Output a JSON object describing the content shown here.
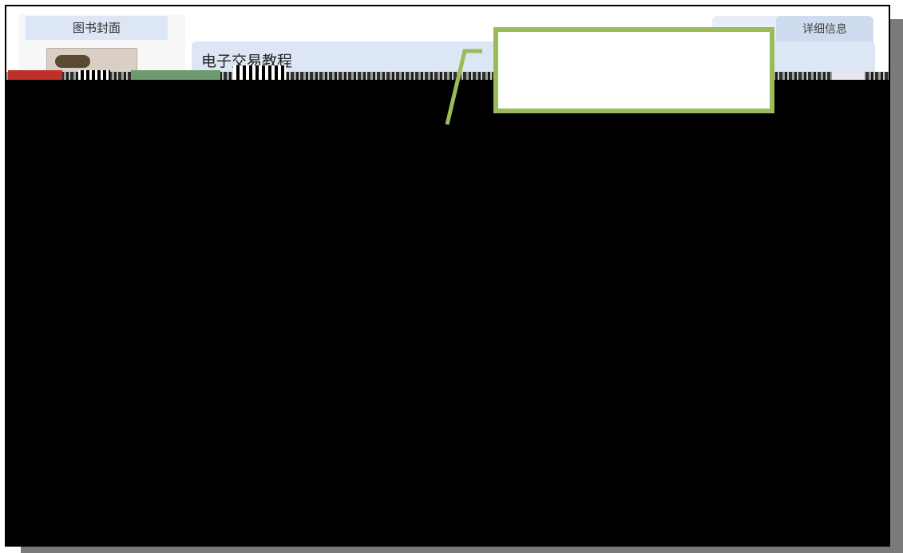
{
  "sidebar": {
    "cover_header": "图书封面"
  },
  "book": {
    "title": "电子交易教程"
  },
  "tabs": [
    {
      "label": ""
    },
    {
      "label": "详细信息"
    }
  ],
  "colors": {
    "header_bg": "#dce6f4",
    "tab_active_bg": "#cfdcef",
    "callout_border": "#9bbb59",
    "redaction": "#000000",
    "shadow": "#7a7a7a"
  },
  "icons": [
    "book-cover-thumbnail",
    "callout-pointer"
  ]
}
